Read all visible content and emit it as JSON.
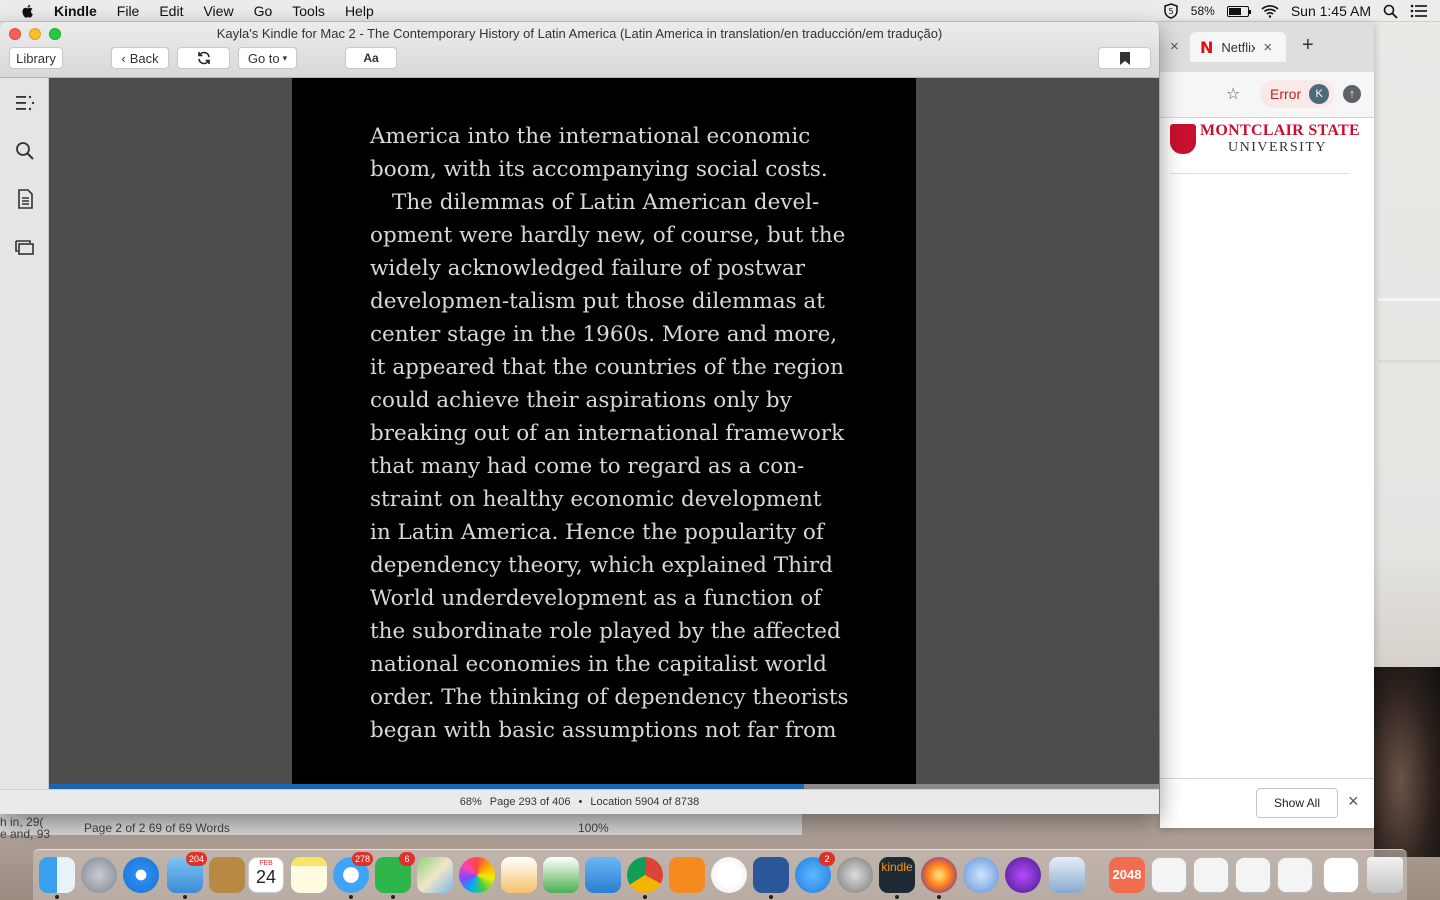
{
  "menubar": {
    "app": "Kindle",
    "items": [
      "File",
      "Edit",
      "View",
      "Go",
      "Tools",
      "Help"
    ],
    "battery_label": "58%",
    "battery_level": 0.58,
    "clock": "Sun 1:45 AM"
  },
  "kindle": {
    "window_title": "Kayla's Kindle for Mac 2 - The Contemporary History of Latin America (Latin America in translation/en traducción/em tradução)",
    "toolbar": {
      "library": "Library",
      "back": "Back",
      "goto": "Go to",
      "font": "Aa"
    },
    "lines": [
      "America into the international economic",
      "boom, with its accompanying social costs.",
      "The dilemmas of Latin American devel-",
      "opment were hardly new, of course, but the",
      "widely acknowledged failure of postwar",
      "developmen-talism put those dilemmas at",
      "center stage in the 1960s. More and more,",
      "it appeared that the countries of the region",
      "could achieve their aspirations only by",
      "breaking out of an international framework",
      "that many had come to regard as a con-",
      "straint on healthy economic development",
      "in Latin America. Hence the popularity of",
      "dependency theory, which explained Third",
      "World underdevelopment as a function of",
      "the subordinate role played by the affected",
      "national economies in the capitalist world",
      "order. The thinking of dependency theorists",
      "began with basic assumptions not far from"
    ],
    "status": {
      "percent": "68%",
      "page": "Page 293 of 406",
      "bullet": "•",
      "location": "Location 5904 of 8738"
    },
    "progress": 0.68
  },
  "browser": {
    "tab_label": "Netflix",
    "tab_close": "×",
    "new_tab": "+",
    "error_label": "Error",
    "profile_initial": "K",
    "logo_line1": "MONTCLAIR STATE",
    "logo_line2": "UNIVERSITY",
    "show_all": "Show All",
    "close": "×"
  },
  "word": {
    "left1": "h in, 29(",
    "left2": "e and, 93",
    "status": "Page 2 of 2     69 of 69 Words",
    "zoom": "100%"
  },
  "dock": {
    "badges": {
      "mail": "204",
      "messages": "278",
      "facetime": "6",
      "appstore": "2"
    },
    "calendar_month": "FEB",
    "calendar_day": "24",
    "game_label": "2048",
    "kindle_label": "kindle"
  },
  "colors": {
    "page_bg": "#000000",
    "page_text": "#d8d8d8",
    "progress": "#1f64b0",
    "msu_red": "#c8102e",
    "error_red": "#c5221f"
  }
}
